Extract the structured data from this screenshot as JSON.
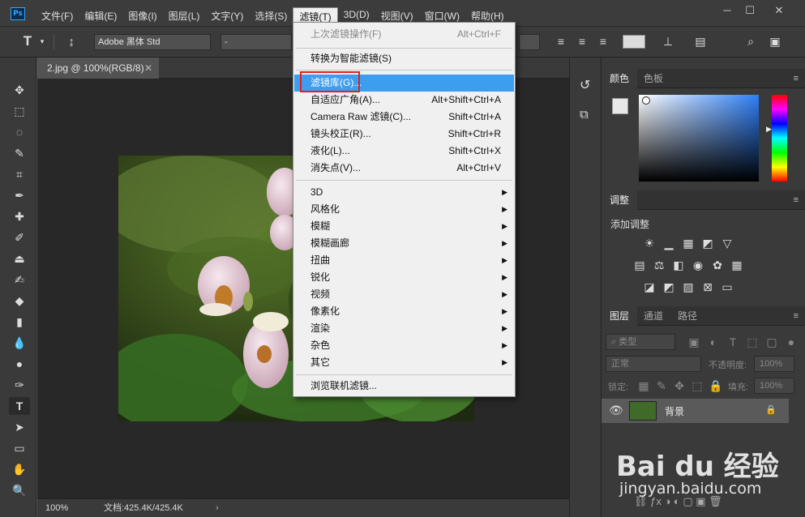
{
  "app": {
    "logo": "Ps"
  },
  "menubar": {
    "items": [
      "文件(F)",
      "编辑(E)",
      "图像(I)",
      "图层(L)",
      "文字(Y)",
      "选择(S)",
      "滤镜(T)",
      "3D(D)",
      "视图(V)",
      "窗口(W)",
      "帮助(H)"
    ],
    "active_index": 6
  },
  "options": {
    "font_family": "Adobe 黑体 Std",
    "font_style": "-"
  },
  "document": {
    "tab_title": "2.jpg @ 100%(RGB/8)",
    "zoom": "100%",
    "doc_info": "文档:425.4K/425.4K"
  },
  "filter_menu": {
    "last_filter": {
      "label": "上次滤镜操作(F)",
      "shortcut": "Alt+Ctrl+F"
    },
    "smart_filter": "转换为智能滤镜(S)",
    "gallery": "滤镜库(G)...",
    "adaptive_wide": {
      "label": "自适应广角(A)...",
      "shortcut": "Alt+Shift+Ctrl+A"
    },
    "camera_raw": {
      "label": "Camera Raw 滤镜(C)...",
      "shortcut": "Shift+Ctrl+A"
    },
    "lens_correction": {
      "label": "镜头校正(R)...",
      "shortcut": "Shift+Ctrl+R"
    },
    "liquify": {
      "label": "液化(L)...",
      "shortcut": "Shift+Ctrl+X"
    },
    "vanishing_point": {
      "label": "消失点(V)...",
      "shortcut": "Alt+Ctrl+V"
    },
    "submenus": [
      "3D",
      "风格化",
      "模糊",
      "模糊画廊",
      "扭曲",
      "锐化",
      "视频",
      "像素化",
      "渲染",
      "杂色",
      "其它"
    ],
    "browse_online": "浏览联机滤镜..."
  },
  "panels": {
    "color_tabs": [
      "颜色",
      "色板"
    ],
    "adjust_tab": "调整",
    "adjust_title": "添加调整",
    "layer_tabs": [
      "图层",
      "通道",
      "路径"
    ],
    "layer_filter": "类型",
    "blend_mode": "正常",
    "opacity_label": "不透明度:",
    "opacity_value": "100%",
    "lock_label": "锁定:",
    "fill_label": "填充:",
    "fill_value": "100%",
    "layer_name": "背景"
  },
  "watermark": {
    "brand": "Bai du 经验",
    "url": "jingyan.baidu.com"
  },
  "colors": {
    "highlight": "#3d9ef0",
    "accent_red": "#e02020",
    "bg": "#535353"
  }
}
